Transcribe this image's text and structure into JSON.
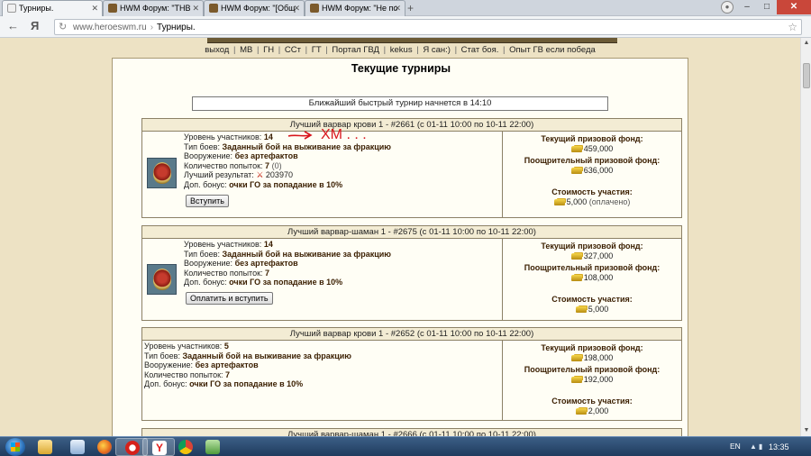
{
  "browser": {
    "tabs": [
      {
        "label": "Турниры."
      },
      {
        "label": "HWM Форум: \"ТНВ"
      },
      {
        "label": "HWM Форум: \"[Общ"
      },
      {
        "label": "HWM Форум: \"Не по"
      }
    ],
    "new_tab": "+",
    "url": {
      "domain": "www.heroeswm.ru",
      "separator": "›",
      "page_title": "Турниры."
    },
    "icons": {
      "back": "back-arrow-icon",
      "yandex": "yandex-icon",
      "reload": "reload-icon",
      "star": "bookmark-star-icon"
    },
    "window_buttons": {
      "minimize": "–",
      "maximize": "□",
      "close": "✕"
    }
  },
  "nav": {
    "links": [
      "выход",
      "МВ",
      "ГН",
      "ССт",
      "ГТ",
      "Портал ГВД",
      "kekus",
      "Я сан:)",
      "Стат боя.",
      "Опыт ГВ если победа"
    ],
    "separator": "|"
  },
  "page": {
    "title": "Текущие турниры",
    "notice": "Ближайший быстрый турнир начнется в 14:10"
  },
  "labels": {
    "level": "Уровень участников:",
    "type": "Тип боев:",
    "weapons": "Вооружение:",
    "attempts": "Количество попыток:",
    "best": "Лучший результат:",
    "bonus": "Доп. бонус:",
    "fund": "Текущий призовой фонд:",
    "incentive": "Поощрительный призовой фонд:",
    "cost": "Стоимость участия:"
  },
  "tournaments": [
    {
      "title": "Лучший варвар крови 1 - #2661 (с 01-11 10:00 по 10-11 22:00)",
      "level": "14",
      "type": "Заданный бой на выживание за фракцию",
      "weapons": "без артефактов",
      "attempts": "7",
      "attempts_used": "(0)",
      "best": "203970",
      "bonus": "очки ГО за попадание в 10%",
      "button": "Вступить",
      "fund": "459,000",
      "incentive": "636,000",
      "cost": "5,000",
      "cost_note": "(оплачено)",
      "annotation": "ХМ . . ."
    },
    {
      "title": "Лучший варвар-шаман 1 - #2675 (с 01-11 10:00 по 10-11 22:00)",
      "level": "14",
      "type": "Заданный бой на выживание за фракцию",
      "weapons": "без артефактов",
      "attempts": "7",
      "bonus": "очки ГО за попадание в 10%",
      "button": "Оплатить и вступить",
      "fund": "327,000",
      "incentive": "108,000",
      "cost": "5,000"
    },
    {
      "title": "Лучший варвар крови 1 - #2652 (с 01-11 10:00 по 10-11 22:00)",
      "level": "5",
      "type": "Заданный бой на выживание за фракцию",
      "weapons": "без артефактов",
      "attempts": "7",
      "bonus": "очки ГО за попадание в 10%",
      "fund": "198,000",
      "incentive": "192,000",
      "cost": "2,000"
    },
    {
      "title": "Лучший варвар-шаман 1 - #2666 (с 01-11 10:00 по 10-11 22:00)"
    }
  ],
  "taskbar": {
    "lang": "EN",
    "time": "13:35",
    "apps": [
      "explorer-icon",
      "documents-icon",
      "firefox-icon",
      "opera-icon",
      "yandex-browser-icon",
      "chrome-icon",
      "network-icon"
    ]
  }
}
